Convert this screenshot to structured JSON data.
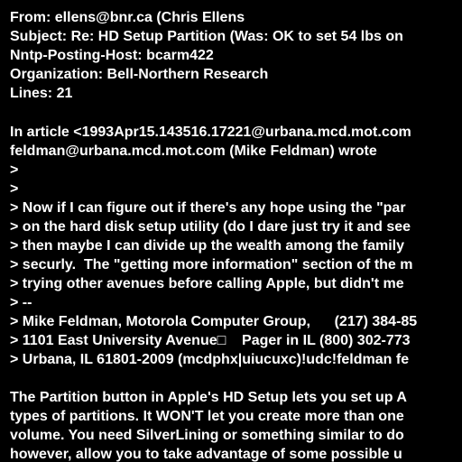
{
  "header": {
    "from": "From: ellens@bnr.ca (Chris Ellens",
    "subject": "Subject: Re: HD Setup Partition (Was: OK to set 54 lbs on",
    "nntp_posting_host": "Nntp-Posting-Host: bcarm422",
    "organization": "Organization: Bell-Northern Research",
    "lines": "Lines: 21"
  },
  "body": {
    "attribution_1": "In article <1993Apr15.143516.17221@urbana.mcd.mot.com",
    "attribution_2": "feldman@urbana.mcd.mot.com (Mike Feldman) wrote",
    "quoted": [
      ">",
      ">",
      "> Now if I can figure out if there's any hope using the \"par",
      "> on the hard disk setup utility (do I dare just try it and see",
      "> then maybe I can divide up the wealth among the family",
      "> securly.  The \"getting more information\" section of the m",
      "> trying other avenues before calling Apple, but didn't me",
      "> --",
      "> Mike Feldman, Motorola Computer Group,      (217) 384-85",
      "> 1101 East University Avenue□    Pager in IL (800) 302-773",
      "> Urbana, IL 61801-2009 (mcdphx|uiucuxc)!udc!feldman fe"
    ],
    "reply": [
      "The Partition button in Apple's HD Setup lets you set up A",
      "types of partitions. It WON'T let you create more than one",
      "volume. You need SilverLining or something similar to do",
      "however, allow you to take advantage of some possible u"
    ]
  }
}
